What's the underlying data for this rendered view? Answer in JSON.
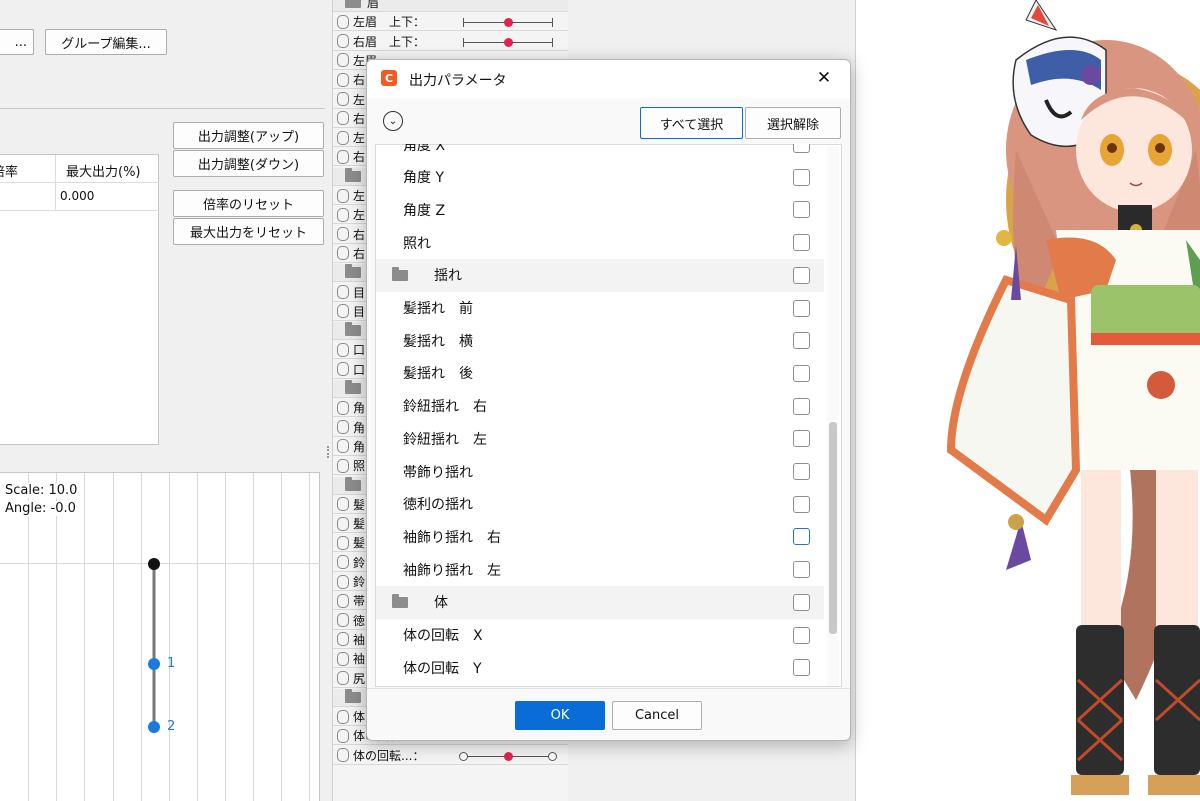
{
  "left_panel": {
    "top_buttons": [
      {
        "label": "..."
      },
      {
        "label": "グループ編集..."
      }
    ],
    "adjust_buttons": {
      "up": "出力調整(アップ)",
      "down": "出力調整(ダウン)",
      "reset_rate": "倍率のリセット",
      "reset_max": "最大出力をリセット"
    },
    "table": {
      "headers": [
        "倍率",
        "最大出力(%)"
      ],
      "rows": [
        [
          "",
          "0.000"
        ]
      ]
    },
    "graph": {
      "scale_text": "Scale: 10.0",
      "angle_text": "Angle: -0.0",
      "point_labels": [
        "1",
        "2"
      ]
    }
  },
  "param_list": {
    "rows": [
      {
        "type": "group",
        "label": "眉"
      },
      {
        "type": "param",
        "label": "左眉　上下：",
        "slider": "center"
      },
      {
        "type": "param",
        "label": "右眉　上下：",
        "slider": "center"
      },
      {
        "type": "param",
        "label": "左眉"
      },
      {
        "type": "param",
        "label": "右"
      },
      {
        "type": "param",
        "label": "左"
      },
      {
        "type": "param",
        "label": "右"
      },
      {
        "type": "param",
        "label": "左"
      },
      {
        "type": "param",
        "label": "右"
      },
      {
        "type": "group",
        "label": ""
      },
      {
        "type": "param",
        "label": "左"
      },
      {
        "type": "param",
        "label": "左"
      },
      {
        "type": "param",
        "label": "右"
      },
      {
        "type": "param",
        "label": "右"
      },
      {
        "type": "group",
        "label": ""
      },
      {
        "type": "param",
        "label": "目"
      },
      {
        "type": "param",
        "label": "目"
      },
      {
        "type": "group",
        "label": ""
      },
      {
        "type": "param",
        "label": "口"
      },
      {
        "type": "param",
        "label": "口"
      },
      {
        "type": "group",
        "label": ""
      },
      {
        "type": "param",
        "label": "角"
      },
      {
        "type": "param",
        "label": "角"
      },
      {
        "type": "param",
        "label": "角"
      },
      {
        "type": "param",
        "label": "照"
      },
      {
        "type": "group",
        "label": ""
      },
      {
        "type": "param",
        "label": "髪"
      },
      {
        "type": "param",
        "label": "髪"
      },
      {
        "type": "param",
        "label": "髪"
      },
      {
        "type": "param",
        "label": "鈴"
      },
      {
        "type": "param",
        "label": "鈴"
      },
      {
        "type": "param",
        "label": "帯"
      },
      {
        "type": "param",
        "label": "徳"
      },
      {
        "type": "param",
        "label": "袖"
      },
      {
        "type": "param",
        "label": "袖"
      },
      {
        "type": "param",
        "label": "尻"
      },
      {
        "type": "group",
        "label": "体"
      },
      {
        "type": "param",
        "label": "体の回転...：",
        "slider": "ring"
      },
      {
        "type": "param",
        "label": "体の回転...：",
        "slider": "ring"
      },
      {
        "type": "param",
        "label": "体の回転...：",
        "slider": "ring"
      }
    ]
  },
  "dialog": {
    "title": "出力パラメータ",
    "close": "✕",
    "select_all": "すべて選択",
    "deselect": "選択解除",
    "rows": [
      {
        "type": "param",
        "label": "角度 X",
        "checked": false
      },
      {
        "type": "param",
        "label": "角度 Y",
        "checked": false
      },
      {
        "type": "param",
        "label": "角度 Z",
        "checked": false
      },
      {
        "type": "param",
        "label": "照れ",
        "checked": false
      },
      {
        "type": "group",
        "label": "揺れ",
        "checked": false
      },
      {
        "type": "param",
        "label": "髪揺れ　前",
        "checked": false
      },
      {
        "type": "param",
        "label": "髪揺れ　横",
        "checked": false
      },
      {
        "type": "param",
        "label": "髪揺れ　後",
        "checked": false
      },
      {
        "type": "param",
        "label": "鈴紐揺れ　右",
        "checked": false
      },
      {
        "type": "param",
        "label": "鈴紐揺れ　左",
        "checked": false
      },
      {
        "type": "param",
        "label": "帯飾り揺れ",
        "checked": false
      },
      {
        "type": "param",
        "label": "徳利の揺れ",
        "checked": false
      },
      {
        "type": "param",
        "label": "袖飾り揺れ　右",
        "checked": false
      },
      {
        "type": "param",
        "label": "袖飾り揺れ　左",
        "checked": false
      },
      {
        "type": "group",
        "label": "体",
        "checked": false
      },
      {
        "type": "param",
        "label": "体の回転　X",
        "checked": false
      },
      {
        "type": "param",
        "label": "体の回転　Y",
        "checked": false
      }
    ],
    "ok": "OK",
    "cancel": "Cancel"
  },
  "colors": {
    "accent": "#0a6cd6",
    "slider_dot": "#e0234f",
    "app_logo": "#f05a23"
  }
}
